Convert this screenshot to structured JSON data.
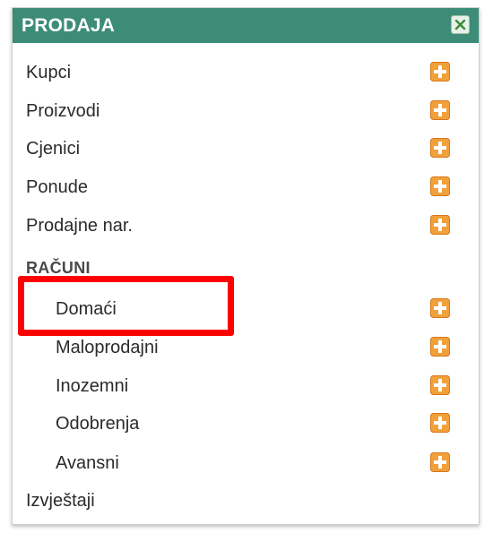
{
  "panel": {
    "title": "PRODAJA"
  },
  "items_top": [
    {
      "label": "Kupci"
    },
    {
      "label": "Proizvodi"
    },
    {
      "label": "Cjenici"
    },
    {
      "label": "Ponude"
    },
    {
      "label": "Prodajne nar."
    }
  ],
  "section": {
    "heading": "RAČUNI",
    "items": [
      {
        "label": "Domaći"
      },
      {
        "label": "Maloprodajni"
      },
      {
        "label": "Inozemni"
      },
      {
        "label": "Odobrenja"
      },
      {
        "label": "Avansni"
      }
    ]
  },
  "items_bottom": [
    {
      "label": "Izvještaji"
    }
  ],
  "colors": {
    "header": "#3c8c78",
    "add_icon": "#f2a03a",
    "highlight": "#ff0000"
  },
  "icons": {
    "close": "close-icon",
    "add": "plus-icon"
  }
}
